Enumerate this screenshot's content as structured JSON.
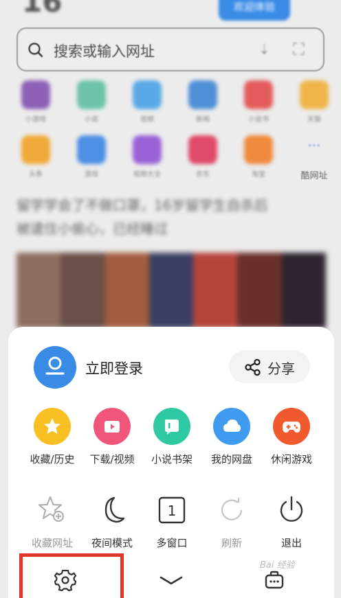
{
  "background": {
    "top_number": "16",
    "top_button_label": "欢迎体验",
    "search_placeholder": "搜索或输入网址",
    "grid_row1": [
      {
        "color": "#8d5fb6",
        "label": "小游戏"
      },
      {
        "color": "#6cc3a8",
        "label": "小说"
      },
      {
        "color": "#58a9e6",
        "label": "视频"
      },
      {
        "color": "#4f8fd6",
        "label": "新闻"
      },
      {
        "color": "#e45b5b",
        "label": "小说书"
      },
      {
        "color": "#f0b44a",
        "label": "天猫"
      }
    ],
    "grid_row2": [
      {
        "color": "#f0a938",
        "label": "头条"
      },
      {
        "color": "#4d8fe4",
        "label": "游戏"
      },
      {
        "color": "#9a62d6",
        "label": "视频大全"
      },
      {
        "color": "#e04a6a",
        "label": "京东"
      },
      {
        "color": "#f08a3c",
        "label": "淘宝"
      }
    ],
    "more_label": "酷网址",
    "news_lines": [
      "留学学会了不做口罩，16岁留学生自杀后",
      "被逮住小偷心，已经睡过"
    ],
    "photo_colors": [
      "#8d6d5e",
      "#6b4f48",
      "#a35c3e",
      "#3a3f63",
      "#b5453a",
      "#6a2f2a",
      "#2e2430"
    ]
  },
  "sheet": {
    "login_label": "立即登录",
    "share_label": "分享",
    "row1": [
      {
        "label": "收藏/历史",
        "color": "#f8c022",
        "icon": "star-icon"
      },
      {
        "label": "下载/视频",
        "color": "#f0557a",
        "icon": "download-video-icon"
      },
      {
        "label": "小说书架",
        "color": "#2ec9a3",
        "icon": "book-icon"
      },
      {
        "label": "我的网盘",
        "color": "#3f9bf0",
        "icon": "cloud-icon"
      },
      {
        "label": "休闲游戏",
        "color": "#f05a2e",
        "icon": "gamepad-icon"
      }
    ],
    "row2": [
      {
        "label": "收藏网址",
        "icon": "bookmark-add-icon",
        "dim": true
      },
      {
        "label": "夜间模式",
        "icon": "moon-icon",
        "dim": false
      },
      {
        "label": "多窗口",
        "icon": "window-count-icon",
        "dim": false,
        "count": "1"
      },
      {
        "label": "刷新",
        "icon": "refresh-icon",
        "dim": true
      },
      {
        "label": "退出",
        "icon": "power-icon",
        "dim": false
      }
    ],
    "watermark": "Bai 经验"
  }
}
